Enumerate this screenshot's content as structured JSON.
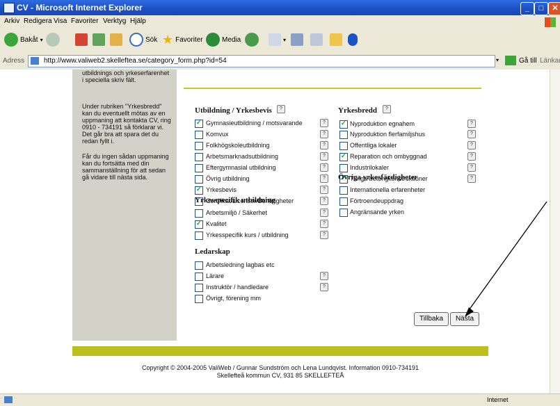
{
  "window": {
    "title": "CV - Microsoft Internet Explorer",
    "min": "_",
    "max": "□",
    "close": "✕"
  },
  "menu": [
    "Arkiv",
    "Redigera",
    "Visa",
    "Favoriter",
    "Verktyg",
    "Hjälp"
  ],
  "toolbar": {
    "back": "Bakåt",
    "search": "Sök",
    "favorites": "Favoriter",
    "media": "Media"
  },
  "address": {
    "label": "Adress",
    "url": "http://www.valiweb2.skelleftea.se/category_form.php?id=54",
    "go": "Gå till",
    "links": "Länkar"
  },
  "sidebar": {
    "para1": "utbildnings och yrkeserfarenhet i speciella skriv fält.",
    "para2": "Under rubriken \"Yrkesbredd\" kan du eventuellt mötas av en uppmaning att kontakta CV, ring 0910 - 734191 så förklarar vi. Det går bra att spara det du redan fyllt i.",
    "para3": "Får du ingen sådan uppmaning kan du fortsätta med din sammanställning för att sedan gå vidare till nästa sida."
  },
  "sections": {
    "utbildning": {
      "title": "Utbildning / Yrkesbevis",
      "items": [
        {
          "label": "Gymnasieutbildning / motsvarande",
          "checked": true
        },
        {
          "label": "Komvux",
          "checked": false
        },
        {
          "label": "Folkhögskoleutbildning",
          "checked": false
        },
        {
          "label": "Arbetsmarknadsutbildning",
          "checked": false
        },
        {
          "label": "Eftergymnasial utbildning",
          "checked": false
        },
        {
          "label": "Övrig utbildning",
          "checked": false
        },
        {
          "label": "Yrkesbevis",
          "checked": true
        },
        {
          "label": "Certifikat/Licenser/Behörigheter",
          "checked": false
        }
      ]
    },
    "yrkesspecifik": {
      "title": "Yrkesspecifik utbildning",
      "items": [
        {
          "label": "Arbetsmiljö / Säkerhet",
          "checked": false
        },
        {
          "label": "Kvalitet",
          "checked": true
        },
        {
          "label": "Yrkesspecifik kurs / utbildning",
          "checked": false
        }
      ]
    },
    "ledarskap": {
      "title": "Ledarskap",
      "items": [
        {
          "label": "Arbetsledning lagbas etc",
          "checked": false
        },
        {
          "label": "Lärare",
          "checked": false
        },
        {
          "label": "Instruktör / handledare",
          "checked": false
        },
        {
          "label": "Övrigt, förening mm",
          "checked": false
        }
      ]
    },
    "yrkesbredd": {
      "title": "Yrkesbredd",
      "items": [
        {
          "label": "Nyproduktion egnahem",
          "checked": true
        },
        {
          "label": "Nyproduktion flerfamiljshus",
          "checked": false
        },
        {
          "label": "Offentliga lokaler",
          "checked": false
        },
        {
          "label": "Reparation och ombyggnad",
          "checked": true
        },
        {
          "label": "Industrilokaler",
          "checked": false
        },
        {
          "label": "Tunga betongkonstruktioner",
          "checked": true
        }
      ]
    },
    "ovriga": {
      "title": "Övriga yrkesfärdigheter",
      "items": [
        {
          "label": "Internationella erfarenheter",
          "checked": false
        },
        {
          "label": "Förtroendeuppdrag",
          "checked": false
        },
        {
          "label": "Angränsande yrken",
          "checked": false
        }
      ]
    }
  },
  "help_glyph": "?",
  "buttons": {
    "back": "Tillbaka",
    "next": "Nästa"
  },
  "footer": {
    "line1": "Copyright © 2004-2005 ValiWeb / Gunnar Sundström och Lena Lundqvist. Information 0910-734191",
    "line2": "Skellefteå kommun CV, 931 85 SKELLEFTEÅ"
  },
  "status": {
    "zone": "Internet"
  },
  "colors": {
    "accent": "#bdbf1e",
    "sidebar": "#d2d2c8",
    "titlebar": "#2f6be0"
  }
}
